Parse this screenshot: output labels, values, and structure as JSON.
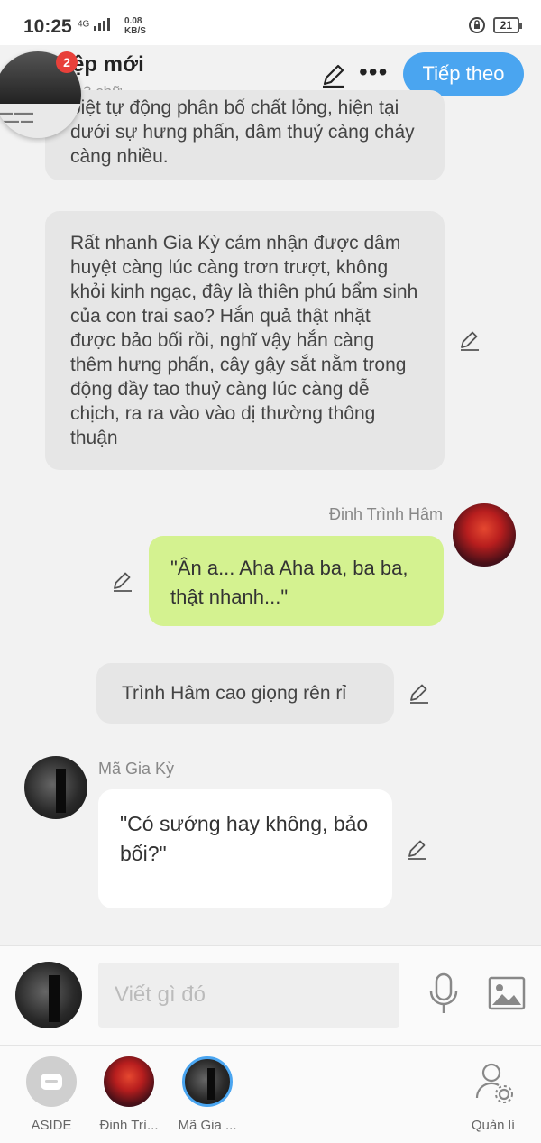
{
  "status_bar": {
    "time": "10:25",
    "network": "4G",
    "speed_value": "0.08",
    "speed_unit": "KB/S",
    "battery": "21"
  },
  "header": {
    "title": "ệp mới",
    "subtitle": "2 chữ",
    "next_button": "Tiếp theo",
    "badge_count": "2"
  },
  "messages": [
    {
      "type": "narration",
      "text": "biệt tự động phân bố chất lỏng, hiện tại dưới sự hưng phấn, dâm thuỷ càng chảy càng nhiều."
    },
    {
      "type": "narration",
      "text": "Rất nhanh Gia Kỳ cảm nhận được dâm huyệt càng lúc càng trơn trượt, không khỏi kinh ngạc, đây là thiên phú bẩm sinh của con trai sao? Hắn quả thật nhặt được bảo bối rồi, nghĩ vậy hắn càng thêm hưng phấn, cây gậy sắt nằm trong động đầy tao thuỷ càng lúc càng dễ chịch, ra ra vào vào dị thường thông thuận"
    },
    {
      "type": "speech_right",
      "speaker": "Đinh Trình Hâm",
      "text": "\"Ân a... Aha Aha ba, ba ba, thật nhanh...\""
    },
    {
      "type": "narration",
      "text": "Trình Hâm cao giọng rên rỉ"
    },
    {
      "type": "speech_left",
      "speaker": "Mã Gia Kỳ",
      "text": "\"Có sướng hay không, bảo bối?\""
    }
  ],
  "input": {
    "placeholder": "Viết gì đó"
  },
  "bottom_tabs": [
    {
      "label": "ASIDE"
    },
    {
      "label": "Đinh Trì..."
    },
    {
      "label": "Mã Gia ..."
    },
    {
      "label": "Quản lí"
    }
  ],
  "colors": {
    "accent": "#4aa5f0",
    "green_bubble": "#d4f290",
    "badge": "#e8403a"
  }
}
